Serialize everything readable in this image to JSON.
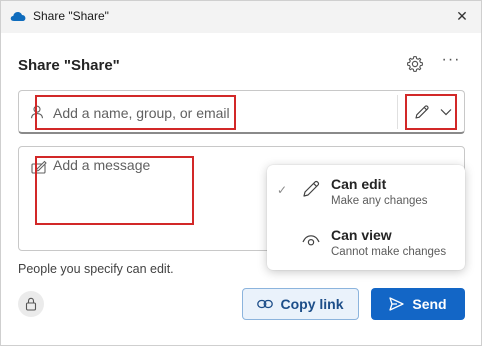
{
  "titlebar": {
    "title": "Share \"Share\"",
    "app_icon": "onedrive-cloud-icon",
    "close_glyph": "✕"
  },
  "dialog": {
    "heading": "Share \"Share\"",
    "settings_icon": "gear-icon",
    "more_glyph": "···"
  },
  "recipient": {
    "placeholder": "Add a name, group, or email",
    "value": "",
    "person_icon": "person-icon",
    "permission_icon": "pencil-icon",
    "chevron_icon": "chevron-down-icon"
  },
  "message": {
    "placeholder": "Add a message",
    "value": "",
    "icon": "message-icon"
  },
  "info_text": "People you specify can edit.",
  "buttons": {
    "copy_link": "Copy link",
    "send": "Send"
  },
  "permissions_menu": {
    "items": [
      {
        "label": "Can edit",
        "description": "Make any changes",
        "icon": "pencil-icon",
        "selected": true,
        "check_glyph": "✓"
      },
      {
        "label": "Can view",
        "description": "Cannot make changes",
        "icon": "eye-icon",
        "selected": false,
        "check_glyph": ""
      }
    ]
  },
  "colors": {
    "accent": "#1366c6",
    "copy_button_bg": "#eaf2fb",
    "highlight_box": "#d22828"
  }
}
